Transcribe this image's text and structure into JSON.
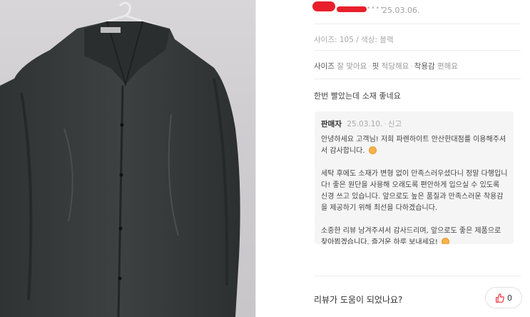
{
  "review": {
    "date": "25.03.06.",
    "option": "사이즈: 105 / 색상: 블랙",
    "attributes": [
      {
        "key": "사이즈",
        "value": "잘 맞아요"
      },
      {
        "key": "핏",
        "value": "적당해요"
      },
      {
        "key": "착용감",
        "value": "편해요"
      }
    ],
    "text": "한번 빨았는데 소재 좋네요",
    "photo_alt": "dark shirt on hanger"
  },
  "seller_reply": {
    "author": "판매자",
    "date": "25.03.10.",
    "report": "신고",
    "paragraphs": [
      "안녕하세요 고객님! 저희 파렌하이트 안산한대점를 이용해주셔서 감사합니다. ",
      "세탁 후에도 소재가 변형 없이 만족스러우셨다니 정말 다행입니다! 좋은 원단을 사용해 오래도록 편안하게 입으실 수 있도록 신경 쓰고 있습니다. 앞으로도 높은 품질과 만족스러운 착용감을 제공하기 위해 최선을 다하겠습니다.",
      "소중한 리뷰 남겨주셔서 감사드리며, 앞으로도 좋은 제품으로 찾아뵙겠습니다. 즐거운 하루 보내세요! "
    ]
  },
  "helpful": {
    "question": "리뷰가 도움이 되었나요?",
    "count": "0"
  },
  "colors": {
    "redaction": "#e8202b",
    "reply_bg": "#f5f5f6",
    "like_icon": "#e8303a"
  },
  "icons": [
    "thumbs-up-icon",
    "smile-emoji-icon"
  ]
}
